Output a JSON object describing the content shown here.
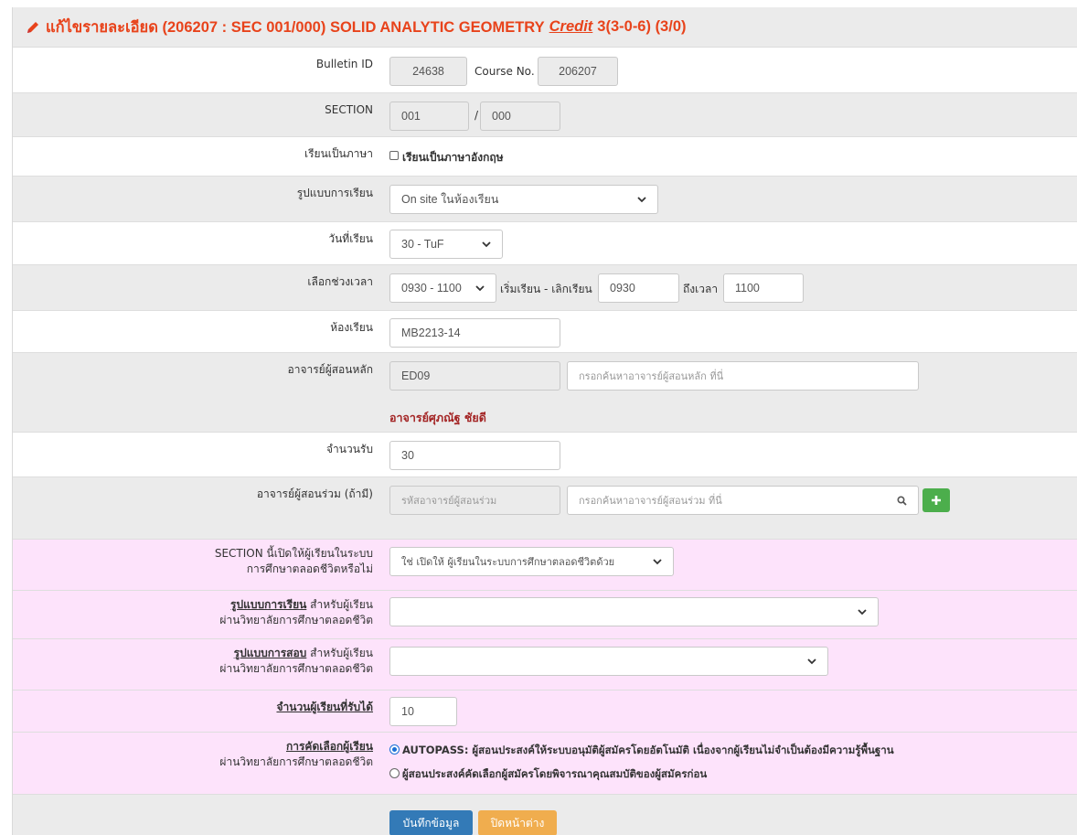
{
  "header": {
    "title": "แก้ไขรายละเอียด (206207 : SEC 001/000) SOLID ANALYTIC GEOMETRY",
    "credit_label": "Credit",
    "credit_value": "3(3-0-6) (3/0)"
  },
  "bulletin": {
    "label": "Bulletin ID",
    "value": "24638",
    "course_label": "Course No.",
    "course_value": "206207"
  },
  "section": {
    "label": "SECTION",
    "lecture": "001",
    "separator": "/",
    "lab": "000"
  },
  "language": {
    "label": "เรียนเป็นภาษา",
    "checkbox_label": "เรียนเป็นภาษาอังกฤษ",
    "checked": false
  },
  "study_mode": {
    "label": "รูปแบบการเรียน",
    "selected": "On site ในห้องเรียน"
  },
  "study_day": {
    "label": "วันที่เรียน",
    "selected": "30 - TuF"
  },
  "time": {
    "label": "เลือกช่วงเวลา",
    "selected": "0930 - 1100",
    "start_label": "เริ่มเรียน - เลิกเรียน",
    "start": "0930",
    "end_label": "ถึงเวลา",
    "end": "1100"
  },
  "room": {
    "label": "ห้องเรียน",
    "value": "MB2213-14"
  },
  "main_instructor": {
    "label": "อาจารย์ผู้สอนหลัก",
    "code": "ED09",
    "search_placeholder": "กรอกค้นหาอาจารย์ผู้สอนหลัก ที่นี่",
    "name": "อาจารย์ศุภณัฐ ชัยดี"
  },
  "capacity": {
    "label": "จำนวนรับ",
    "value": "30"
  },
  "co_instructor": {
    "label": "อาจารย์ผู้สอนร่วม (ถ้ามี)",
    "code_placeholder": "รหัสอาจารย์ผู้สอนร่วม",
    "search_placeholder": "กรอกค้นหาอาจารย์ผู้สอนร่วม ที่นี่"
  },
  "lifelong": {
    "open_label_line1": "SECTION นี้เปิดให้ผู้เรียนในระบบ",
    "open_label_line2": "การศึกษาตลอดชีวิตหรือไม่",
    "open_selected": "ใช่ เปิดให้ ผู้เรียนในระบบการศึกษาตลอดชีวิตด้วย",
    "mode_label_u": "รูปแบบการเรียน",
    "mode_label_rest": "สำหรับผู้เรียน",
    "mode_label_line2": "ผ่านวิทยาลัยการศึกษาตลอดชีวิต",
    "mode_selected": "",
    "exam_label_u": "รูปแบบการสอบ",
    "exam_label_rest": "สำหรับผู้เรียน",
    "exam_label_line2": "ผ่านวิทยาลัยการศึกษาตลอดชีวิต",
    "exam_selected": "",
    "count_label": "จำนวนผู้เรียนที่รับได้",
    "count_value": "10",
    "selection_label_u": "การคัดเลือกผู้เรียน",
    "selection_label_line2": "ผ่านวิทยาลัยการศึกษาตลอดชีวิต",
    "option1": "AUTOPASS: ผู้สอนประสงค์ให้ระบบอนุมัติผู้สมัครโดยอัตโนมัติ เนื่องจากผู้เรียนไม่จำเป็นต้องมีความรู้พื้นฐาน",
    "option2": "ผู้สอนประสงค์คัดเลือกผู้สมัครโดยพิจารณาคุณสมบัติของผู้สมัครก่อน",
    "selected_option": 1
  },
  "actions": {
    "save": "บันทึกข้อมูล",
    "close": "ปิดหน้าต่าง"
  },
  "colors": {
    "header_text": "#e8431b",
    "pink_row": "#fde3fb",
    "save_button": "#337ab7",
    "close_button": "#f0ad4e",
    "add_button": "#4cae4c"
  }
}
